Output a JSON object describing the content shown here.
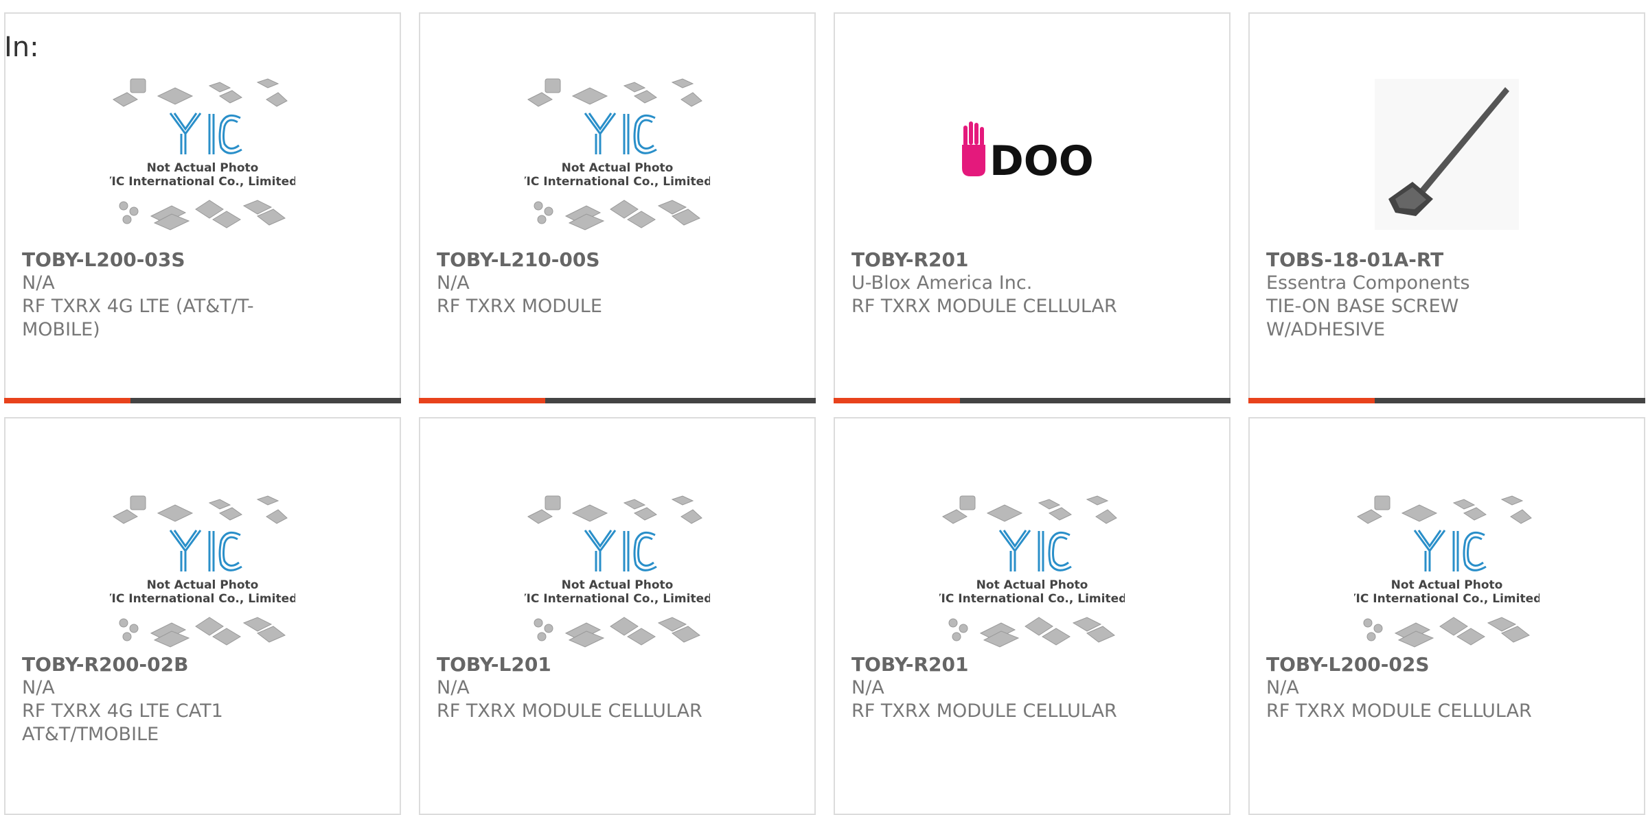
{
  "filter": {
    "label": "In:"
  },
  "placeholder_image": {
    "logo_text": "YIC",
    "caption_line1": "Not Actual Photo",
    "caption_line2": "YIC International Co., Limited."
  },
  "udoo_logo": {
    "text": "DOO"
  },
  "colors": {
    "accent": "#e8421c",
    "bar": "#444444",
    "border": "#dcdcdc",
    "yic_blue": "#2a8fc9",
    "udoo_pink": "#e4197c"
  },
  "products": [
    {
      "part": "TOBY-L200-03S",
      "manufacturer": "N/A",
      "description": "RF TXRX 4G LTE (AT&T/T-MOBILE)",
      "image": "placeholder-image"
    },
    {
      "part": "TOBY-L210-00S",
      "manufacturer": "N/A",
      "description": "RF TXRX MODULE",
      "image": "placeholder-image"
    },
    {
      "part": "TOBY-R201",
      "manufacturer": "U-Blox America Inc.",
      "description": "RF TXRX MODULE CELLULAR",
      "image": "udoo-logo"
    },
    {
      "part": "TOBS-18-01A-RT",
      "manufacturer": "Essentra Components",
      "description": "TIE-ON BASE SCREW W/ADHESIVE",
      "image": "cable-tie-photo"
    },
    {
      "part": "TOBY-R200-02B",
      "manufacturer": "N/A",
      "description": "RF TXRX 4G LTE CAT1 AT&T/TMOBILE",
      "image": "placeholder-image"
    },
    {
      "part": "TOBY-L201",
      "manufacturer": "N/A",
      "description": "RF TXRX MODULE CELLULAR",
      "image": "placeholder-image"
    },
    {
      "part": "TOBY-R201",
      "manufacturer": "N/A",
      "description": "RF TXRX MODULE CELLULAR",
      "image": "placeholder-image"
    },
    {
      "part": "TOBY-L200-02S",
      "manufacturer": "N/A",
      "description": "RF TXRX MODULE CELLULAR",
      "image": "placeholder-image"
    }
  ]
}
